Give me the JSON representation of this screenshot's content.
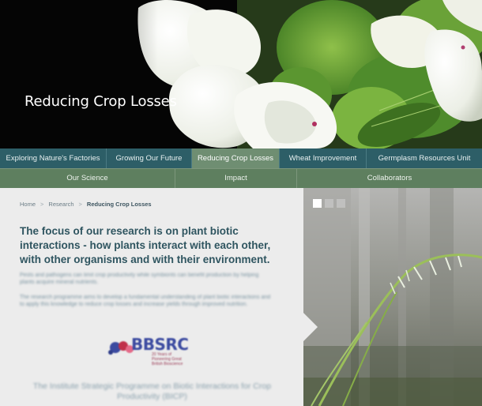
{
  "hero": {
    "title": "Reducing Crop Losses"
  },
  "nav_primary": {
    "items": [
      {
        "label": "Exploring Nature's Factories",
        "active": false
      },
      {
        "label": "Growing Our Future",
        "active": false
      },
      {
        "label": "Reducing Crop Losses",
        "active": true
      },
      {
        "label": "Wheat Improvement",
        "active": false
      },
      {
        "label": "Germplasm Resources Unit",
        "active": false
      }
    ]
  },
  "nav_secondary": {
    "items": [
      {
        "label": "Our Science"
      },
      {
        "label": "Impact"
      },
      {
        "label": "Collaborators"
      }
    ]
  },
  "breadcrumb": {
    "home": "Home",
    "research": "Research",
    "current": "Reducing Crop Losses",
    "separator": ">"
  },
  "main": {
    "lead": "The focus of our research is on plant biotic interactions - how plants interact with each other, with other organisms and with their environment.",
    "para1": "Pests and pathogens can limit crop productivity while symbionts can benefit production by helping plants acquire mineral nutrients.",
    "para2": "The research programme aims to develop a fundamental understanding of plant biotic interactions and to apply this knowledge to reduce crop losses and increase yields through improved nutrition.",
    "logo_text": "BBSRC",
    "logo_sub": "20 Years of Pioneering Great British Bioscience",
    "footer": "The Institute Strategic Programme on Biotic Interactions for Crop Productivity (BICP)"
  },
  "slideshow": {
    "slide_count": 3,
    "active_index": 0
  },
  "colors": {
    "nav_primary_bg": "#2d5e67",
    "nav_active_bg": "#6f8e72",
    "nav_secondary_bg": "#5e7f5f",
    "lead_text": "#2f5560",
    "content_bg": "#ececec"
  }
}
